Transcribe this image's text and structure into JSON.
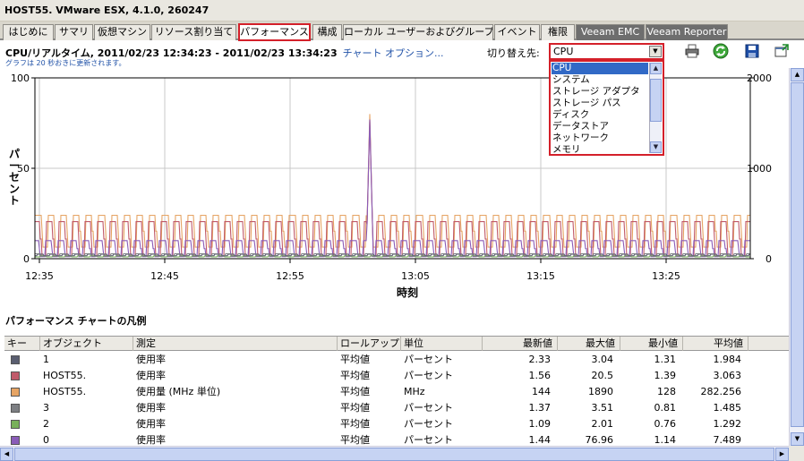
{
  "window": {
    "title": "HOST55. VMware ESX, 4.1.0, 260247"
  },
  "tabs": [
    {
      "label": "はじめに"
    },
    {
      "label": "サマリ"
    },
    {
      "label": "仮想マシン"
    },
    {
      "label": "リソース割り当て"
    },
    {
      "label": "パフォーマンス",
      "active": true
    },
    {
      "label": "構成"
    },
    {
      "label": "ローカル ユーザーおよびグループ"
    },
    {
      "label": "イベント"
    },
    {
      "label": "権限"
    },
    {
      "label": "Veeam EMC"
    },
    {
      "label": "Veeam Reporter"
    }
  ],
  "header": {
    "title": "CPU/リアルタイム, 2011/02/23 12:34:23 - 2011/02/23 13:34:23",
    "chart_options_link": "チャート オプション...",
    "refresh_note": "グラフは 20 秒おきに更新されます。",
    "switch_label": "切り替え先:",
    "switch_value": "CPU",
    "switch_options": [
      "CPU",
      "システム",
      "ストレージ アダプタ",
      "ストレージ パス",
      "ディスク",
      "データストア",
      "ネットワーク",
      "メモリ"
    ],
    "selected_option": "CPU"
  },
  "toolbar": {
    "icons": [
      "print-icon",
      "refresh-icon",
      "save-icon",
      "popout-icon"
    ]
  },
  "colors": {
    "series_0": "#5a5e70",
    "series_1": "#c05a6a",
    "series_2": "#e6a464",
    "series_3": "#7d7f83",
    "series_4": "#78b05a",
    "series_5": "#8a5cb8",
    "accent_red": "#d4202a",
    "link_blue": "#2253a8"
  },
  "chart_data": {
    "type": "line",
    "xlabel": "時刻",
    "ylabel": "パーセント",
    "ylim": [
      0,
      100
    ],
    "y2lim": [
      0,
      2000
    ],
    "y_ticks": [
      "0",
      "50",
      "100"
    ],
    "y2_ticks": [
      "0",
      "1000",
      "2000"
    ],
    "x_ticks": [
      "12:35",
      "12:45",
      "12:55",
      "13:05",
      "13:15",
      "13:25"
    ],
    "grid": true,
    "series": [
      {
        "name": "HOST55.",
        "axis": "right",
        "pattern": "periodic",
        "low": 128,
        "high": 480,
        "spike": 1600
      },
      {
        "name": "HOST55.",
        "axis": "left",
        "pattern": "periodic",
        "low": 1.39,
        "high": 20.5,
        "spike": 76
      },
      {
        "name": "0",
        "axis": "left",
        "pattern": "periodic",
        "low": 1.14,
        "high": 10,
        "spike": 76.96
      },
      {
        "name": "2",
        "axis": "left",
        "pattern": "flat",
        "low": 0.76,
        "high": 2.01
      },
      {
        "name": "1",
        "axis": "left",
        "pattern": "flat",
        "low": 1.31,
        "high": 3.04
      },
      {
        "name": "3",
        "axis": "left",
        "pattern": "flat",
        "low": 0.81,
        "high": 3.51
      }
    ]
  },
  "legend": {
    "title": "パフォーマンス チャートの凡例",
    "columns": [
      "キー",
      "オブジェクト",
      "測定",
      "ロールアップ",
      "単位",
      "最新値",
      "最大値",
      "最小値",
      "平均値"
    ],
    "rows": [
      {
        "color": "#5a5e70",
        "object": "1",
        "measure": "使用率",
        "rollup": "平均値",
        "unit": "パーセント",
        "latest": "2.33",
        "max": "3.04",
        "min": "1.31",
        "avg": "1.984"
      },
      {
        "color": "#c05a6a",
        "object": "HOST55.",
        "measure": "使用率",
        "rollup": "平均値",
        "unit": "パーセント",
        "latest": "1.56",
        "max": "20.5",
        "min": "1.39",
        "avg": "3.063"
      },
      {
        "color": "#e6a464",
        "object": "HOST55.",
        "measure": "使用量 (MHz 単位)",
        "rollup": "平均値",
        "unit": "MHz",
        "latest": "144",
        "max": "1890",
        "min": "128",
        "avg": "282.256"
      },
      {
        "color": "#7d7f83",
        "object": "3",
        "measure": "使用率",
        "rollup": "平均値",
        "unit": "パーセント",
        "latest": "1.37",
        "max": "3.51",
        "min": "0.81",
        "avg": "1.485"
      },
      {
        "color": "#78b05a",
        "object": "2",
        "measure": "使用率",
        "rollup": "平均値",
        "unit": "パーセント",
        "latest": "1.09",
        "max": "2.01",
        "min": "0.76",
        "avg": "1.292"
      },
      {
        "color": "#8a5cb8",
        "object": "0",
        "measure": "使用率",
        "rollup": "平均値",
        "unit": "パーセント",
        "latest": "1.44",
        "max": "76.96",
        "min": "1.14",
        "avg": "7.489"
      }
    ]
  }
}
